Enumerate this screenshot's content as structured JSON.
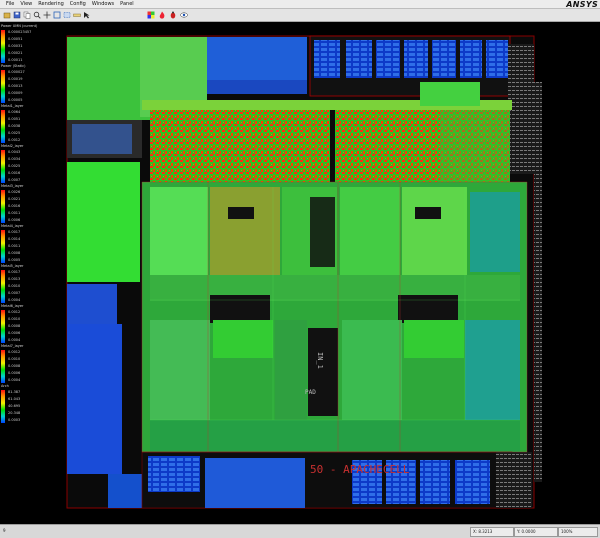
{
  "menu": [
    "File",
    "View",
    "Rendering",
    "Config",
    "Windows",
    "Panel"
  ],
  "brand": "ANSYS",
  "toolbar_icons": [
    "open-icon",
    "save-icon",
    "copy-icon",
    "zoom-icon",
    "pan-icon",
    "fit-icon",
    "select-icon",
    "measure-icon",
    "arrow-icon",
    "palette-icon",
    "flame-icon",
    "bug-icon",
    "eye-icon"
  ],
  "legend": [
    {
      "title": "Power UMN (current)",
      "values": [
        "0.000023457",
        "0.00051",
        "0.00031",
        "0.00021",
        "0.00011"
      ]
    },
    {
      "title": "Power (Static)",
      "values": [
        "0.000027",
        "0.00019",
        "0.00013",
        "0.00009",
        "0.00005"
      ]
    },
    {
      "title": "Metal1_layer",
      "values": [
        "0.0064",
        "0.0051",
        "0.0038",
        "0.0025",
        "0.0012"
      ]
    },
    {
      "title": "Metal2_layer",
      "values": [
        "0.0043",
        "0.0034",
        "0.0025",
        "0.0016",
        "0.0007"
      ]
    },
    {
      "title": "Metal3_layer",
      "values": [
        "0.0026",
        "0.0021",
        "0.0016",
        "0.0011",
        "0.0006"
      ]
    },
    {
      "title": "Metal4_layer",
      "values": [
        "0.0017",
        "0.0014",
        "0.0011",
        "0.0008",
        "0.0005"
      ]
    },
    {
      "title": "Metal5_layer",
      "values": [
        "0.0017",
        "0.0013",
        "0.0010",
        "0.0007",
        "0.0004"
      ]
    },
    {
      "title": "Metal6_layer",
      "values": [
        "0.0012",
        "0.0010",
        "0.0008",
        "0.0006",
        "0.0004"
      ]
    },
    {
      "title": "Metal7_layer",
      "values": [
        "0.0012",
        "0.0010",
        "0.0008",
        "0.0006",
        "0.0004"
      ]
    },
    {
      "title": "Arch",
      "values": [
        "81.387",
        "61.043",
        "40.695",
        "20.348",
        "0.0003"
      ]
    }
  ],
  "layout_labels": {
    "cell_label": "50 - APACHECELL",
    "block_label_a": "IN_1",
    "block_label_b": "PAD"
  },
  "status": {
    "left": "9",
    "coord_a": "X: 8.3213",
    "coord_b": "Y: 0.0000",
    "zoom": "100%"
  }
}
